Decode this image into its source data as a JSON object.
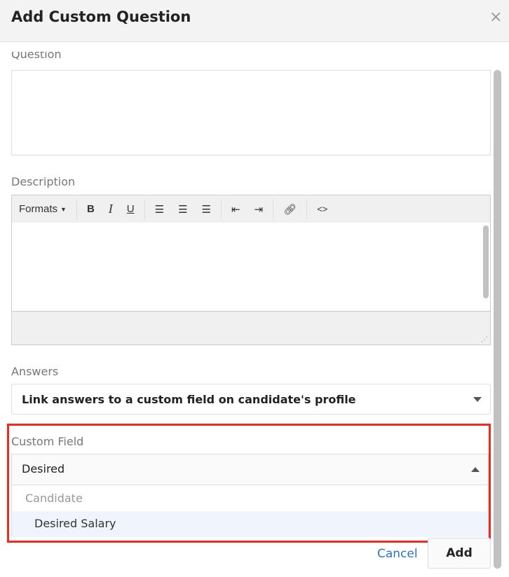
{
  "dialog": {
    "title": "Add Custom Question",
    "close_icon": "×"
  },
  "question": {
    "label": "Question",
    "value": ""
  },
  "description": {
    "label": "Description",
    "toolbar": {
      "formats": "Formats",
      "bold": "B",
      "italic": "I",
      "underline": "U",
      "code": "<>"
    }
  },
  "answers": {
    "label": "Answers",
    "selected": "Link answers to a custom field on candidate's profile"
  },
  "custom_field": {
    "label": "Custom Field",
    "value": "Desired",
    "group": "Candidate",
    "options": [
      "Desired Salary"
    ]
  },
  "footer": {
    "cancel": "Cancel",
    "add": "Add"
  },
  "colors": {
    "highlight_border": "#f0281e",
    "link": "#2d74c4",
    "option_highlight": "#eef5fd"
  }
}
